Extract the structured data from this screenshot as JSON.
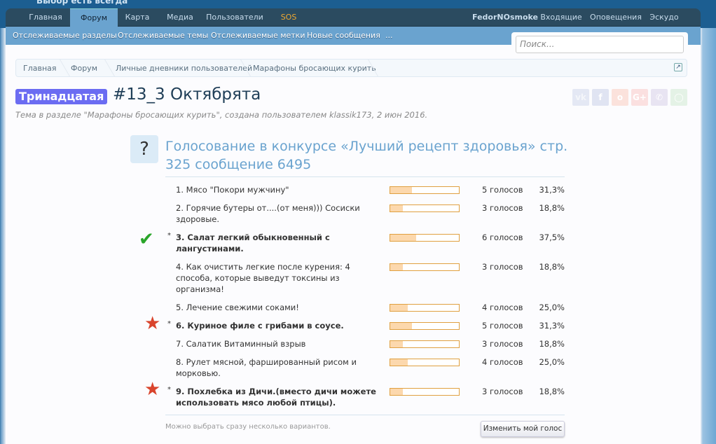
{
  "site": {
    "slogan": "Выбор есть всегда"
  },
  "nav": {
    "tabs": [
      "Главная",
      "Форум",
      "Карта",
      "Медиа",
      "Пользователи",
      "SOS"
    ],
    "active": "Форум",
    "user": "FedorNOsmoke",
    "inbox": "Входящие",
    "alerts": "Оповещения",
    "logout": "Эскудо"
  },
  "subnav": [
    "Отслеживаемые разделы",
    "Отслеживаемые темы",
    "Отслеживаемые метки",
    "Новые сообщения",
    "..."
  ],
  "search": {
    "placeholder": "Поиск..."
  },
  "breadcrumbs": [
    "Главная",
    "Форум",
    "Личные дневники пользователей",
    "Марафоны бросающих курить"
  ],
  "thread": {
    "prefix": "Тринадцатая",
    "prefix_color": "#6b6cf2",
    "title": "#13_3 Октябрята",
    "subtitle": "Тема в разделе \"Марафоны бросающих курить\", создана пользователем klassik173, 2 июн 2016."
  },
  "social": [
    "vk-icon",
    "facebook-icon",
    "odnoklassniki-icon",
    "google-plus-icon",
    "viber-icon",
    "whatsapp-icon"
  ],
  "poll": {
    "icon": "?",
    "title": "Голосование в конкурсе «Лучший рецепт здоровья» стр. 325 сообщение 6495",
    "options": [
      {
        "text": "1. Мясо \"Покори мужчину\"",
        "votes": "5 голосов",
        "pct": "31,3%",
        "value": 31.3,
        "mine": false
      },
      {
        "text": "2. Горячие бутеры от....(от меня))) Сосиски здоровые.",
        "votes": "3 голосов",
        "pct": "18,8%",
        "value": 18.8,
        "mine": false
      },
      {
        "text": "3. Салат легкий обыкновенный с лангустинами.",
        "votes": "6 голосов",
        "pct": "37,5%",
        "value": 37.5,
        "mine": true,
        "mark": "check"
      },
      {
        "text": "4. Как очистить легкие после курения: 4 способа, которые выведут токсины из организма!",
        "votes": "3 голосов",
        "pct": "18,8%",
        "value": 18.8,
        "mine": false
      },
      {
        "text": "5. Лечение свежими соками!",
        "votes": "4 голосов",
        "pct": "25,0%",
        "value": 25.0,
        "mine": false
      },
      {
        "text": "6. Куриное филе с грибами в соусе.",
        "votes": "5 голосов",
        "pct": "31,3%",
        "value": 31.3,
        "mine": true,
        "mark": "star"
      },
      {
        "text": "7. Салатик Витаминный взрыв",
        "votes": "3 голосов",
        "pct": "18,8%",
        "value": 18.8,
        "mine": false
      },
      {
        "text": "8. Рулет мясной, фаршированный рисом и морковью.",
        "votes": "4 голосов",
        "pct": "25,0%",
        "value": 25.0,
        "mine": false
      },
      {
        "text": "9. Похлебка из Дичи.(вместо дичи можете использовать мясо любой птицы).",
        "votes": "3 голосов",
        "pct": "18,8%",
        "value": 18.8,
        "mine": true,
        "mark": "star"
      }
    ],
    "mine_marker": "*",
    "hint": "Можно выбрать сразу несколько вариантов.",
    "change_vote": "Изменить мой голос"
  }
}
